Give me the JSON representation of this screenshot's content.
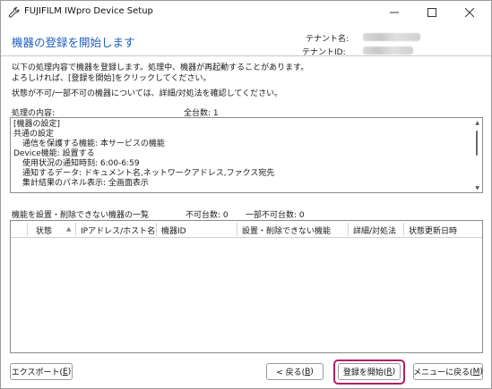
{
  "window": {
    "title": "FUJIFILM IWpro Device Setup",
    "icons": {
      "app": "wrench-icon",
      "minimize": "minimize-icon",
      "maximize": "maximize-icon",
      "close": "close-icon"
    }
  },
  "header": {
    "page_title": "機器の登録を開始します",
    "tenant_name_label": "テナント名:",
    "tenant_id_label": "テナントID:"
  },
  "description": {
    "line1": "以下の処理内容で機器を登録します。処理中、機器が再起動することがあります。",
    "line2": "よろしければ、[登録を開始]をクリックしてください。",
    "line3": "状態が不可/一部不可の機器については、詳細/対処法を確認してください。"
  },
  "processing": {
    "label": "処理の内容:",
    "total_label": "全台数: 1",
    "lines": [
      "[機器の設定]",
      "共通の設定",
      "通信を保護する機能: 本サービスの機能",
      "Device機能: 設置する",
      "使用状況の通知時刻: 6:00-6:59",
      "通知するデータ: ドキュメント名,ネットワークアドレス,ファクス宛先",
      "集計結果のパネル表示: 全画面表示"
    ]
  },
  "device_list": {
    "label": "機能を設置・削除できない機器の一覧",
    "cannot_count_label": "不可台数: 0",
    "partial_count_label": "一部不可台数: 0",
    "columns": [
      "状態",
      "IPアドレス/ホスト名",
      "機器ID",
      "設置・削除できない機能",
      "詳細/対処法",
      "状態更新日時"
    ],
    "rows": []
  },
  "buttons": {
    "export": {
      "label": "エクスポート(",
      "key": "E",
      "suffix": ")"
    },
    "back": {
      "label": "< 戻る(",
      "key": "B",
      "suffix": ")"
    },
    "register": {
      "label": "登録を開始(",
      "key": "R",
      "suffix": ")"
    },
    "menu": {
      "label": "メニューに戻る(",
      "key": "M",
      "suffix": ")"
    }
  },
  "colors": {
    "title_blue": "#1f5fbf",
    "highlight": "#b01e66"
  }
}
